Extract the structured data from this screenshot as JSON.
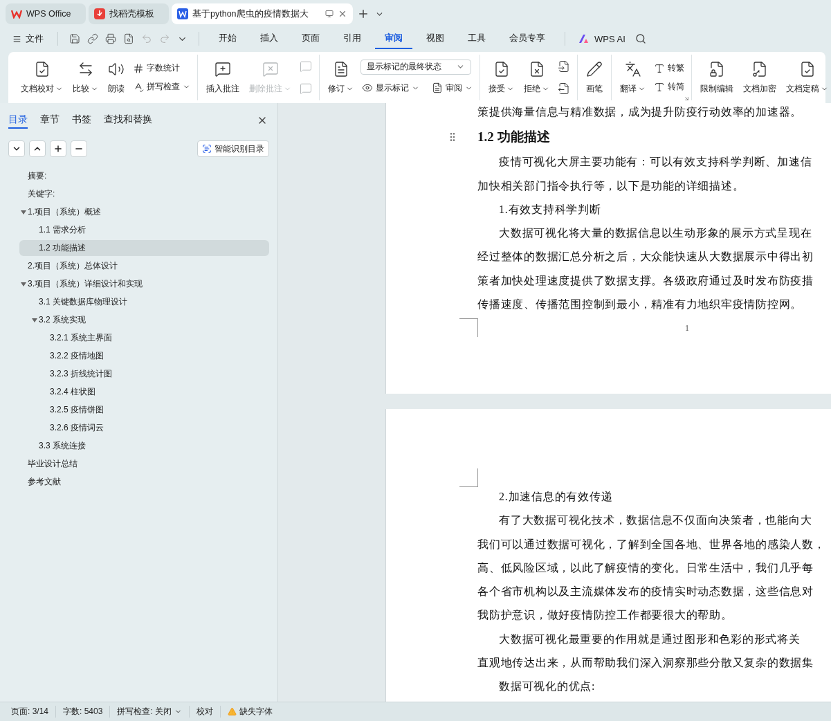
{
  "tabs": [
    {
      "label": "WPS Office",
      "selected": false
    },
    {
      "label": "找稻壳模板",
      "selected": false
    },
    {
      "label": "基于python爬虫的疫情数据大",
      "selected": true
    }
  ],
  "menu": {
    "file": "文件",
    "tabs": [
      {
        "label": "开始",
        "selected": false
      },
      {
        "label": "插入",
        "selected": false
      },
      {
        "label": "页面",
        "selected": false
      },
      {
        "label": "引用",
        "selected": false
      },
      {
        "label": "审阅",
        "selected": true
      },
      {
        "label": "视图",
        "selected": false
      },
      {
        "label": "工具",
        "selected": false
      },
      {
        "label": "会员专享",
        "selected": false
      }
    ],
    "ai": "WPS AI"
  },
  "ribbon": [
    {
      "items": [
        {
          "kind": "large",
          "label": "文档校对",
          "caret": true,
          "disabled": false
        },
        {
          "kind": "large",
          "label": "比较",
          "caret": true,
          "disabled": false
        },
        {
          "kind": "large",
          "label": "朗读",
          "caret": false,
          "disabled": false
        },
        {
          "kind": "stack",
          "items": [
            {
              "label": "字数统计",
              "caret": false,
              "disabled": false
            },
            {
              "label": "拼写检查",
              "caret": true,
              "disabled": false
            }
          ]
        }
      ]
    },
    {
      "items": [
        {
          "kind": "large",
          "label": "插入批注",
          "caret": false,
          "disabled": false
        },
        {
          "kind": "large",
          "label": "删除批注",
          "caret": true,
          "disabled": true
        },
        {
          "kind": "icon_stack",
          "disabled": true
        }
      ]
    },
    {
      "items": [
        {
          "kind": "large",
          "label": "修订",
          "caret": true,
          "disabled": false
        },
        {
          "kind": "select_block",
          "select": "显示标记的最终状态",
          "items": [
            {
              "label": "显示标记",
              "caret": true,
              "disabled": false
            },
            {
              "label": "审阅",
              "caret": true,
              "disabled": false
            }
          ]
        }
      ]
    },
    {
      "items": [
        {
          "kind": "large",
          "label": "接受",
          "caret": true,
          "disabled": false
        },
        {
          "kind": "large",
          "label": "拒绝",
          "caret": true,
          "disabled": false
        },
        {
          "kind": "icon_stack",
          "disabled": false
        }
      ]
    },
    {
      "items": [
        {
          "kind": "large",
          "label": "画笔",
          "caret": false,
          "disabled": false
        }
      ]
    },
    {
      "items": [
        {
          "kind": "large",
          "label": "翻译",
          "caret": true,
          "disabled": false
        },
        {
          "kind": "stack",
          "items": [
            {
              "label": "转繁",
              "caret": false,
              "disabled": false
            },
            {
              "label": "转简",
              "caret": false,
              "disabled": false
            }
          ]
        }
      ]
    },
    {
      "items": [
        {
          "kind": "large",
          "label": "限制编辑",
          "caret": false,
          "disabled": false
        },
        {
          "kind": "large",
          "label": "文档加密",
          "caret": false,
          "disabled": false
        },
        {
          "kind": "large",
          "label": "文档定稿",
          "caret": true,
          "disabled": false
        }
      ]
    }
  ],
  "sidebar": {
    "tabs": [
      {
        "label": "目录",
        "selected": true
      },
      {
        "label": "章节",
        "selected": false
      },
      {
        "label": "书签",
        "selected": false
      },
      {
        "label": "查找和替换",
        "selected": false
      }
    ],
    "smart_button": "智能识别目录",
    "toc": [
      {
        "label": "摘要:",
        "selected": false
      },
      {
        "label": "关键字:",
        "selected": false
      },
      {
        "label": "1.项目（系统）概述",
        "selected": false,
        "expanded": true,
        "children": [
          {
            "label": "1.1 需求分析",
            "selected": false
          },
          {
            "label": "1.2 功能描述",
            "selected": true
          }
        ]
      },
      {
        "label": "2.项目（系统）总体设计",
        "selected": false
      },
      {
        "label": "3.项目（系统）详细设计和实现",
        "selected": false,
        "expanded": true,
        "children": [
          {
            "label": "3.1 关键数据库物理设计",
            "selected": false
          },
          {
            "label": "3.2 系统实现",
            "selected": false,
            "expanded": true,
            "children": [
              {
                "label": "3.2.1 系统主界面",
                "selected": false
              },
              {
                "label": "3.2.2 疫情地图",
                "selected": false
              },
              {
                "label": "3.2.3 折线统计图",
                "selected": false
              },
              {
                "label": "3.2.4 柱状图",
                "selected": false
              },
              {
                "label": "3.2.5 疫情饼图",
                "selected": false
              },
              {
                "label": "3.2.6 疫情词云",
                "selected": false
              }
            ]
          },
          {
            "label": "3.3 系统连接",
            "selected": false
          }
        ]
      },
      {
        "label": "毕业设计总结",
        "selected": false
      },
      {
        "label": "参考文献",
        "selected": false
      }
    ]
  },
  "pages": [
    {
      "blocks": [
        {
          "kind": "paragraph",
          "lines": [
            "策提供海量信息与精准数据，成为提升防疫行动效率的加速器。"
          ],
          "first_indent": false
        },
        {
          "kind": "heading",
          "text": "1.2 功能描述"
        },
        {
          "kind": "paragraph",
          "lines": [
            "疫情可视化大屏主要功能有：可以有效支持科学判断、加速信",
            "加快相关部门指令执行等，以下是功能的详细描述。"
          ],
          "first_indent": true
        },
        {
          "kind": "paragraph",
          "lines": [
            "1.有效支持科学判断"
          ],
          "first_indent": true
        },
        {
          "kind": "paragraph",
          "lines": [
            "大数据可视化将大量的数据信息以生动形象的展示方式呈现在",
            "经过整体的数据汇总分析之后，大众能快速从大数据展示中得出初",
            "策者加快处理速度提供了数据支撑。各级政府通过及时发布防疫措",
            "传播速度、传播范围控制到最小，精准有力地织牢疫情防控网。"
          ],
          "first_indent": true
        }
      ],
      "page_number": "1"
    },
    {
      "blocks": [
        {
          "kind": "paragraph",
          "lines": [
            "2.加速信息的有效传递"
          ],
          "first_indent": true
        },
        {
          "kind": "paragraph",
          "lines": [
            "有了大数据可视化技术，数据信息不仅面向决策者，也能向大",
            "我们可以通过数据可视化，了解到全国各地、世界各地的感染人数，",
            "高、低风险区域，以此了解疫情的变化。日常生活中，我们几乎每",
            "各个省市机构以及主流媒体发布的疫情实时动态数据，这些信息对",
            "我防护意识，做好疫情防控工作都要很大的帮助。"
          ],
          "first_indent": true
        },
        {
          "kind": "paragraph",
          "lines": [
            "大数据可视化最重要的作用就是通过图形和色彩的形式将关",
            "直观地传达出来，从而帮助我们深入洞察那些分散又复杂的数据集"
          ],
          "first_indent": true
        },
        {
          "kind": "paragraph",
          "lines": [
            "数据可视化的优点:"
          ],
          "first_indent": true
        }
      ]
    }
  ],
  "status_bar": [
    {
      "kind": "text",
      "label": "页面: 3/14"
    },
    {
      "kind": "text",
      "label": "字数: 5403"
    },
    {
      "kind": "dropdown",
      "label": "拼写检查: 关闭"
    },
    {
      "kind": "text",
      "label": "校对"
    },
    {
      "kind": "warning",
      "label": "缺失字体"
    }
  ]
}
